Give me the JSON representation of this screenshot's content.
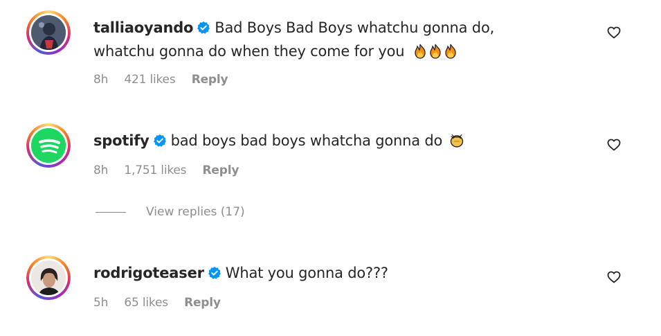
{
  "comments": [
    {
      "username": "talliaoyando",
      "text_line1": "Bad Boys Bad Boys whatchu gonna do,",
      "text_line2": "whatchu gonna do when they come for you",
      "emoji": "🔥🔥🔥",
      "time": "8h",
      "likes": "421 likes",
      "reply": "Reply"
    },
    {
      "username": "spotify",
      "text_line1": "bad boys bad boys whatcha gonna do",
      "emoji": "👏",
      "time": "8h",
      "likes": "1,751 likes",
      "reply": "Reply",
      "view_replies": "View replies (17)"
    },
    {
      "username": "rodrigoteaser",
      "text_line1": "What you gonna do???",
      "time": "5h",
      "likes": "65 likes",
      "reply": "Reply"
    }
  ],
  "colors": {
    "verified": "#0095f6",
    "muted": "#8e8e8e",
    "spotify_green": "#1ed760"
  },
  "icons": [
    "verified-badge-icon",
    "heart-icon",
    "fire-emoji",
    "clap-emoji"
  ]
}
